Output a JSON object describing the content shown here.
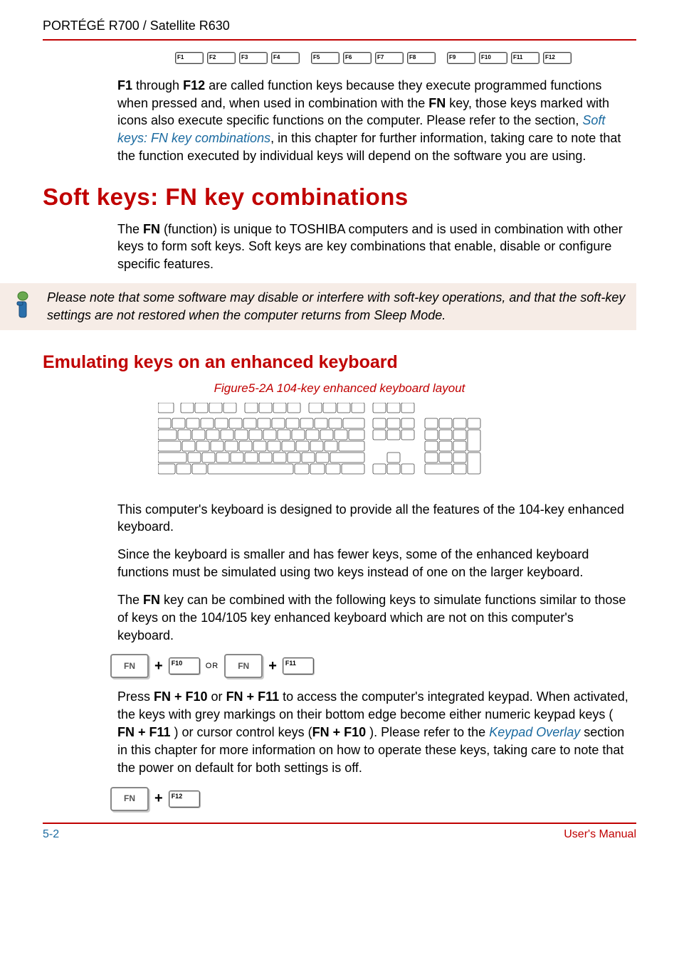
{
  "header": {
    "title": "PORTÉGÉ R700 / Satellite R630"
  },
  "fkeys": [
    "F1",
    "F2",
    "F3",
    "F4",
    "F5",
    "F6",
    "F7",
    "F8",
    "F9",
    "F10",
    "F11",
    "F12"
  ],
  "intro": {
    "p1a": "F1",
    "p1b": " through ",
    "p1c": "F12",
    "p1d": " are called function keys because they execute programmed functions when pressed and, when used in combination with the ",
    "p1e": "FN",
    "p1f": " key, those keys marked with icons also execute specific functions on the computer. Please refer to the section, ",
    "p1link": "Soft keys: FN key combinations",
    "p1g": ", in this chapter for further information, taking care to note that the function executed by individual keys will depend on the software you are using."
  },
  "section1": {
    "title": "Soft keys: FN key combinations",
    "p1a": "The ",
    "p1b": "FN",
    "p1c": " (function) is unique to TOSHIBA computers and is used in combination with other keys to form soft keys. Soft keys are key combinations that enable, disable or configure specific features."
  },
  "note": {
    "text": "Please note that some software may disable or interfere with soft-key operations, and that the soft-key settings are not restored when the computer returns from Sleep Mode."
  },
  "section2": {
    "title": "Emulating keys on an enhanced keyboard",
    "caption": "Figure5-2A 104-key enhanced keyboard layout",
    "p1": "This computer's keyboard is designed to provide all the features of the 104-key enhanced keyboard.",
    "p2": "Since the keyboard is smaller and has fewer keys, some of the enhanced keyboard functions must be simulated using two keys instead of one on the larger keyboard.",
    "p3a": "The ",
    "p3b": "FN",
    "p3c": " key can be combined with the following keys to simulate functions similar to those of keys on the 104/105 key enhanced keyboard which are not on this computer's keyboard.",
    "combo1": {
      "fn": "FN",
      "plus": "+",
      "k1": "F10",
      "or": "OR",
      "k2": "F11"
    },
    "p4a": "Press ",
    "p4b": "FN + F10",
    "p4c": " or ",
    "p4d": "FN + F11",
    "p4e": " to access the computer's integrated keypad. When activated, the keys with grey markings on their bottom edge become either numeric keypad keys ( ",
    "p4f": "FN + F11",
    "p4g": " ) or cursor control keys (",
    "p4h": "FN + F10",
    "p4i": " ). Please refer to the ",
    "p4link": "Keypad Overlay",
    "p4j": " section in this chapter for more information on how to operate these keys, taking care to note that the power on default for both settings is off.",
    "combo2": {
      "fn": "FN",
      "plus": "+",
      "k": "F12"
    }
  },
  "footer": {
    "page": "5-2",
    "manual": "User's Manual"
  }
}
